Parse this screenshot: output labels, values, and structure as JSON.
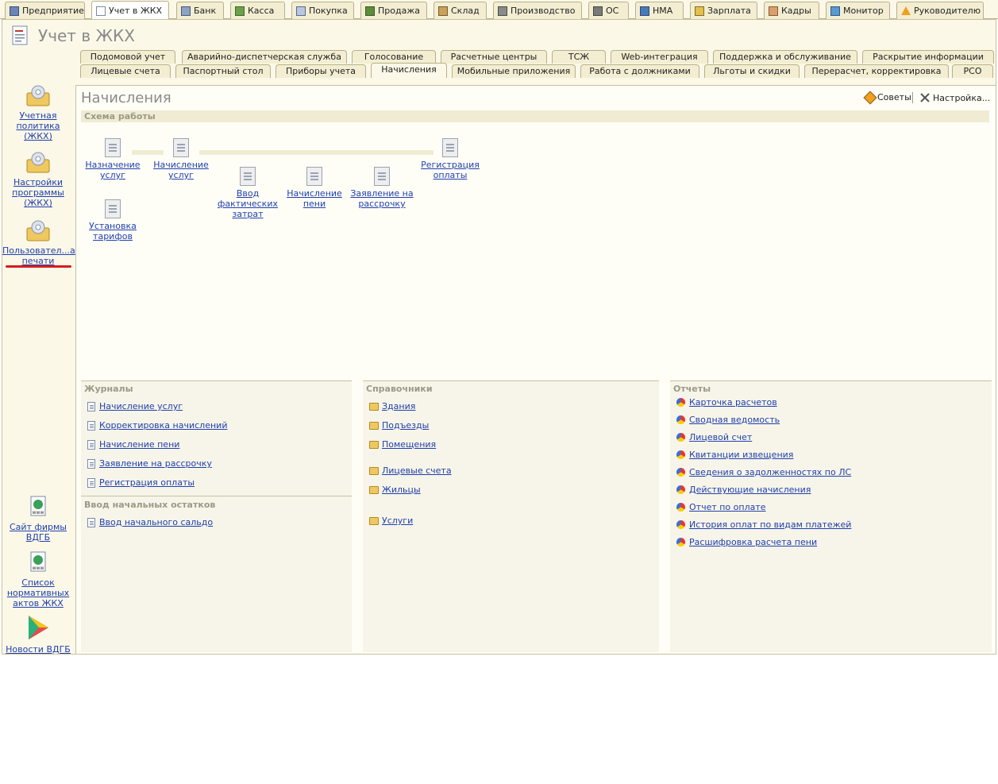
{
  "top_tabs": [
    {
      "label": "Предприятие",
      "icon": "building-icon",
      "active": false
    },
    {
      "label": "Учет в ЖКХ",
      "icon": "document-icon",
      "active": true
    },
    {
      "label": "Банк",
      "icon": "bank-icon",
      "active": false
    },
    {
      "label": "Касса",
      "icon": "cash-register-icon",
      "active": false
    },
    {
      "label": "Покупка",
      "icon": "purchase-icon",
      "active": false
    },
    {
      "label": "Продажа",
      "icon": "sale-icon",
      "active": false
    },
    {
      "label": "Склад",
      "icon": "warehouse-icon",
      "active": false
    },
    {
      "label": "Производство",
      "icon": "production-icon",
      "active": false
    },
    {
      "label": "ОС",
      "icon": "truck-icon",
      "active": false
    },
    {
      "label": "НМА",
      "icon": "nma-icon",
      "active": false
    },
    {
      "label": "Зарплата",
      "icon": "salary-icon",
      "active": false
    },
    {
      "label": "Кадры",
      "icon": "personnel-icon",
      "active": false
    },
    {
      "label": "Монитор",
      "icon": "monitor-chart-icon",
      "active": false
    },
    {
      "label": "Руководителю",
      "icon": "warning-icon",
      "active": false
    }
  ],
  "section": {
    "title": "Учет в ЖКХ"
  },
  "sub_tabs_row1": [
    "Подомовой учет",
    "Аварийно-диспетчерская служба",
    "Голосование",
    "Расчетные центры",
    "ТСЖ",
    "Web-интеграция",
    "Поддержка и обслуживание",
    "Раскрытие информации"
  ],
  "sub_tabs_row2": [
    "Лицевые счета",
    "Паспортный стол",
    "Приборы учета",
    "Начисления",
    "Мобильные приложения",
    "Работа с должниками",
    "Льготы и скидки",
    "Перерасчет, корректировка",
    "РСО"
  ],
  "sub_tabs_active": "Начисления",
  "left_panel": {
    "items": [
      "Учетная политика (ЖКХ)",
      "Настройки программы (ЖКХ)",
      "Пользовател...акеты печати"
    ],
    "bottom_items": [
      "Сайт фирмы ВДГБ",
      "Список нормативных актов ЖКХ",
      "Новости ВДГБ"
    ]
  },
  "content": {
    "title": "Начисления",
    "tips_label": "Советы",
    "settings_label": "Настройка...",
    "scheme_header": "Схема работы",
    "scheme": {
      "assign": "Назначение услуг",
      "accrual": "Начисление услуг",
      "payment": "Регистрация оплаты",
      "actual_costs": "Ввод фактических затрат",
      "penalty": "Начисление пени",
      "installment": "Заявление на рассрочку",
      "tariffs": "Установка тарифов"
    },
    "journals": {
      "header": "Журналы",
      "items": [
        "Начисление услуг",
        "Корректировка начислений",
        "Начисление пени",
        "Заявление на рассрочку",
        "Регистрация оплаты"
      ],
      "opening_header": "Ввод начальных остатков",
      "opening_items": [
        "Ввод начального сальдо"
      ]
    },
    "catalogs": {
      "header": "Справочники",
      "items": [
        "Здания",
        "Подъезды",
        "Помещения",
        "Лицевые счета",
        "Жильцы",
        "Услуги"
      ]
    },
    "reports": {
      "header": "Отчеты",
      "items": [
        "Карточка расчетов",
        "Сводная ведомость",
        "Лицевой счет",
        "Квитанции извещения",
        "Сведения о задолженностях по ЛС",
        "Действующие начисления",
        "Отчет по оплате",
        "История оплат по видам платежей",
        "Расшифровка расчета пени"
      ]
    }
  },
  "colors": {
    "link": "#1f3fae",
    "frame_bg": "#fbf8e8",
    "highlight_underline": "#d81c1c"
  }
}
